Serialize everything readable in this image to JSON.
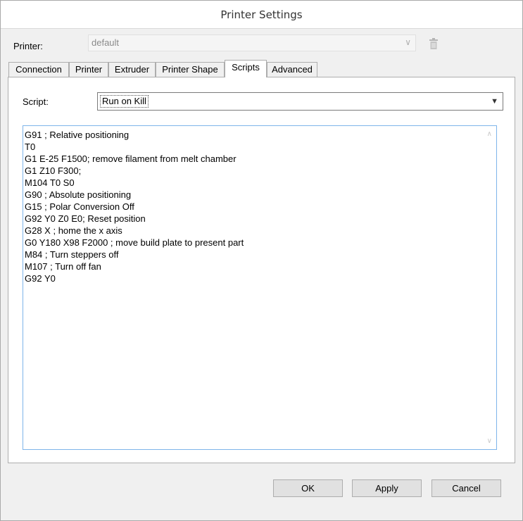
{
  "window": {
    "title": "Printer Settings"
  },
  "printer": {
    "label": "Printer:",
    "value": "default"
  },
  "tabs": [
    {
      "label": "Connection"
    },
    {
      "label": "Printer"
    },
    {
      "label": "Extruder"
    },
    {
      "label": "Printer Shape"
    },
    {
      "label": "Scripts"
    },
    {
      "label": "Advanced"
    }
  ],
  "active_tab": "Scripts",
  "script": {
    "label": "Script:",
    "selected": "Run on Kill"
  },
  "code": {
    "lines": [
      "G91 ; Relative positioning",
      "T0",
      "G1 E-25 F1500; remove filament from melt chamber",
      "G1 Z10 F300;",
      "M104 T0 S0",
      "G90 ; Absolute positioning",
      "G15 ; Polar Conversion Off",
      "G92 Y0 Z0 E0; Reset position",
      "G28 X ; home the x axis",
      "G0 Y180 X98 F2000 ; move build plate to present part",
      "M84 ; Turn steppers off",
      "M107 ; Turn off fan",
      "G92 Y0"
    ]
  },
  "buttons": {
    "ok": "OK",
    "apply": "Apply",
    "cancel": "Cancel"
  },
  "icons": {
    "printer_dropdown": "chevron-down-icon",
    "delete": "trash-icon",
    "script_dropdown": "chevron-down-icon"
  }
}
